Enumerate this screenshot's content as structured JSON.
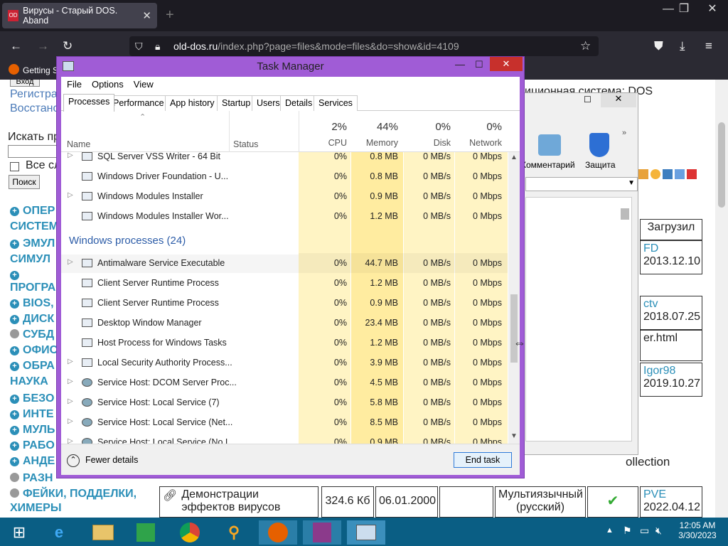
{
  "browser": {
    "tab_title": "Вирусы - Старый DOS. Aband",
    "url_host": "old-dos.ru",
    "url_path": "/index.php?page=files&mode=files&do=show&id=4109",
    "bookmark": "Getting S"
  },
  "page": {
    "login_button": "Вход",
    "register": "Регистра",
    "restore": "Восстано",
    "search_label": "Искать пр",
    "all_label": "Все сл",
    "search_button": "Поиск",
    "partial_top": "иционная система: DOS",
    "menu": [
      {
        "icon": "plus",
        "text": "ОПЕР"
      },
      {
        "icon": "none",
        "text": "СИСТЕМ"
      },
      {
        "icon": "plus",
        "text": "ЭМУЛ"
      },
      {
        "icon": "none",
        "text": "СИМУЛ"
      },
      {
        "icon": "plus",
        "text": ""
      },
      {
        "icon": "none",
        "text": "ПРОГРА"
      },
      {
        "icon": "plus",
        "text": "BIOS,"
      },
      {
        "icon": "plus",
        "text": "ДИСК"
      },
      {
        "icon": "dot",
        "text": "СУБД"
      },
      {
        "icon": "plus",
        "text": "ОФИС"
      },
      {
        "icon": "plus",
        "text": "ОБРА"
      },
      {
        "icon": "none",
        "text": "НАУКА"
      },
      {
        "icon": "plus",
        "text": "БЕЗО"
      },
      {
        "icon": "plus",
        "text": "ИНТЕ"
      },
      {
        "icon": "plus",
        "text": "МУЛЬ"
      },
      {
        "icon": "plus",
        "text": "РАБО"
      },
      {
        "icon": "plus",
        "text": "АНДЕ"
      },
      {
        "icon": "dot",
        "text": "РАЗН"
      },
      {
        "icon": "dot",
        "text": "ФЕЙКИ, ПОДДЕЛКИ,"
      },
      {
        "icon": "none",
        "text": "ХИМЕРЫ"
      }
    ],
    "uploaded_header": "Загрузил",
    "uploads": [
      {
        "user": "FD",
        "date": "2013.12.10"
      },
      {
        "user": "ctv",
        "date": "2018.07.25"
      },
      {
        "user": "Igor98",
        "date": "2019.10.27"
      }
    ],
    "html_fragment": "er.html",
    "collection_fragment": "ollection",
    "demo_row": {
      "name": "Демонстрации эффектов вирусов",
      "size": "324.6 Кб",
      "date": "06.01.2000",
      "language": "Мультиязычный (русский)",
      "user": "PVE",
      "user_date": "2022.04.12"
    },
    "toolbar_comment": "Комментарий",
    "toolbar_protect": "Защита"
  },
  "taskmanager": {
    "title": "Task Manager",
    "menu": [
      "File",
      "Options",
      "View"
    ],
    "tabs": [
      "Processes",
      "Performance",
      "App history",
      "Startup",
      "Users",
      "Details",
      "Services"
    ],
    "columns": {
      "name": "Name",
      "status": "Status",
      "cpu_pct": "2%",
      "cpu": "CPU",
      "mem_pct": "44%",
      "mem": "Memory",
      "disk_pct": "0%",
      "disk": "Disk",
      "net_pct": "0%",
      "net": "Network"
    },
    "group_label": "Windows processes (24)",
    "rows_top": [
      {
        "name": "SQL Server VSS Writer - 64 Bit",
        "expand": true,
        "cpu": "0%",
        "mem": "0.8 MB",
        "disk": "0 MB/s",
        "net": "0 Mbps"
      },
      {
        "name": "Windows Driver Foundation - U...",
        "expand": false,
        "cpu": "0%",
        "mem": "0.8 MB",
        "disk": "0 MB/s",
        "net": "0 Mbps"
      },
      {
        "name": "Windows Modules Installer",
        "expand": true,
        "cpu": "0%",
        "mem": "0.9 MB",
        "disk": "0 MB/s",
        "net": "0 Mbps"
      },
      {
        "name": "Windows Modules Installer Wor...",
        "expand": false,
        "cpu": "0%",
        "mem": "1.2 MB",
        "disk": "0 MB/s",
        "net": "0 Mbps"
      }
    ],
    "rows_win": [
      {
        "name": "Antimalware Service Executable",
        "expand": true,
        "icon": "box",
        "cpu": "0%",
        "mem": "44.7 MB",
        "disk": "0 MB/s",
        "net": "0 Mbps"
      },
      {
        "name": "Client Server Runtime Process",
        "expand": false,
        "icon": "box",
        "cpu": "0%",
        "mem": "1.2 MB",
        "disk": "0 MB/s",
        "net": "0 Mbps"
      },
      {
        "name": "Client Server Runtime Process",
        "expand": false,
        "icon": "box",
        "cpu": "0%",
        "mem": "0.9 MB",
        "disk": "0 MB/s",
        "net": "0 Mbps"
      },
      {
        "name": "Desktop Window Manager",
        "expand": false,
        "icon": "box",
        "cpu": "0%",
        "mem": "23.4 MB",
        "disk": "0 MB/s",
        "net": "0 Mbps"
      },
      {
        "name": "Host Process for Windows Tasks",
        "expand": false,
        "icon": "box",
        "cpu": "0%",
        "mem": "1.2 MB",
        "disk": "0 MB/s",
        "net": "0 Mbps"
      },
      {
        "name": "Local Security Authority Process...",
        "expand": true,
        "icon": "box",
        "cpu": "0%",
        "mem": "3.9 MB",
        "disk": "0 MB/s",
        "net": "0 Mbps"
      },
      {
        "name": "Service Host: DCOM Server Proc...",
        "expand": true,
        "icon": "gear",
        "cpu": "0%",
        "mem": "4.5 MB",
        "disk": "0 MB/s",
        "net": "0 Mbps"
      },
      {
        "name": "Service Host: Local Service (7)",
        "expand": true,
        "icon": "gear",
        "cpu": "0%",
        "mem": "5.8 MB",
        "disk": "0 MB/s",
        "net": "0 Mbps"
      },
      {
        "name": "Service Host: Local Service (Net...",
        "expand": true,
        "icon": "gear",
        "cpu": "0%",
        "mem": "8.5 MB",
        "disk": "0 MB/s",
        "net": "0 Mbps"
      },
      {
        "name": "Service Host: Local Service (No I...",
        "expand": true,
        "icon": "gear",
        "cpu": "0%",
        "mem": "0.9 MB",
        "disk": "0 MB/s",
        "net": "0 Mbps"
      }
    ],
    "fewer_details": "Fewer details",
    "end_task": "End task"
  },
  "taskbar": {
    "time": "12:05 AM",
    "date": "3/30/2023"
  },
  "colors": {
    "tm_frame": "#a05cd6",
    "heat": "#fff4c4",
    "heat_mem": "#ffeca0",
    "taskbar": "#0a5e84",
    "link_blue": "#2c5fa8"
  }
}
